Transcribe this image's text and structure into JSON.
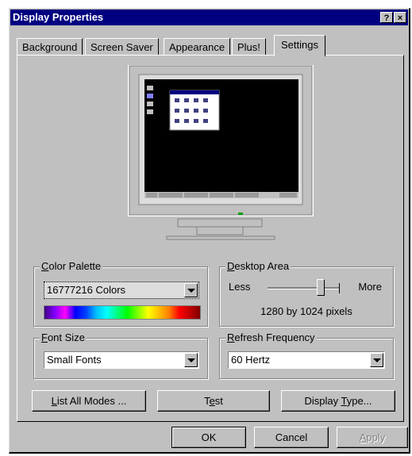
{
  "window": {
    "title": "Display Properties",
    "help_button": "?",
    "close_button": "×"
  },
  "tabs": [
    {
      "label": "Background"
    },
    {
      "label": "Screen Saver"
    },
    {
      "label": "Appearance"
    },
    {
      "label": "Plus!"
    },
    {
      "label": "Settings",
      "selected": true
    }
  ],
  "color_palette": {
    "label_accel": "C",
    "label_rest": "olor Palette",
    "selected": "16777216 Colors"
  },
  "desktop_area": {
    "label_accel": "D",
    "label_rest": "esktop Area",
    "less": "Less",
    "more": "More",
    "resolution": "1280 by 1024 pixels",
    "slider_value": 0.75
  },
  "font_size": {
    "label_accel": "F",
    "label_rest": "ont Size",
    "selected": "Small Fonts"
  },
  "refresh_frequency": {
    "label_accel": "R",
    "label_rest": "efresh Frequency",
    "selected": "60 Hertz"
  },
  "buttons": {
    "list_all_modes_accel": "L",
    "list_all_modes_rest": "ist All Modes ...",
    "test_pre": "T",
    "test_accel": "e",
    "test_rest": "st",
    "display_type_pre": "Display ",
    "display_type_accel": "T",
    "display_type_rest": "ype...",
    "ok": "OK",
    "cancel": "Cancel",
    "apply_accel": "A",
    "apply_rest": "pply"
  },
  "colors": {
    "titlebar": "#000080",
    "face": "#c0c0c0",
    "preview_desktop": "#000000"
  }
}
